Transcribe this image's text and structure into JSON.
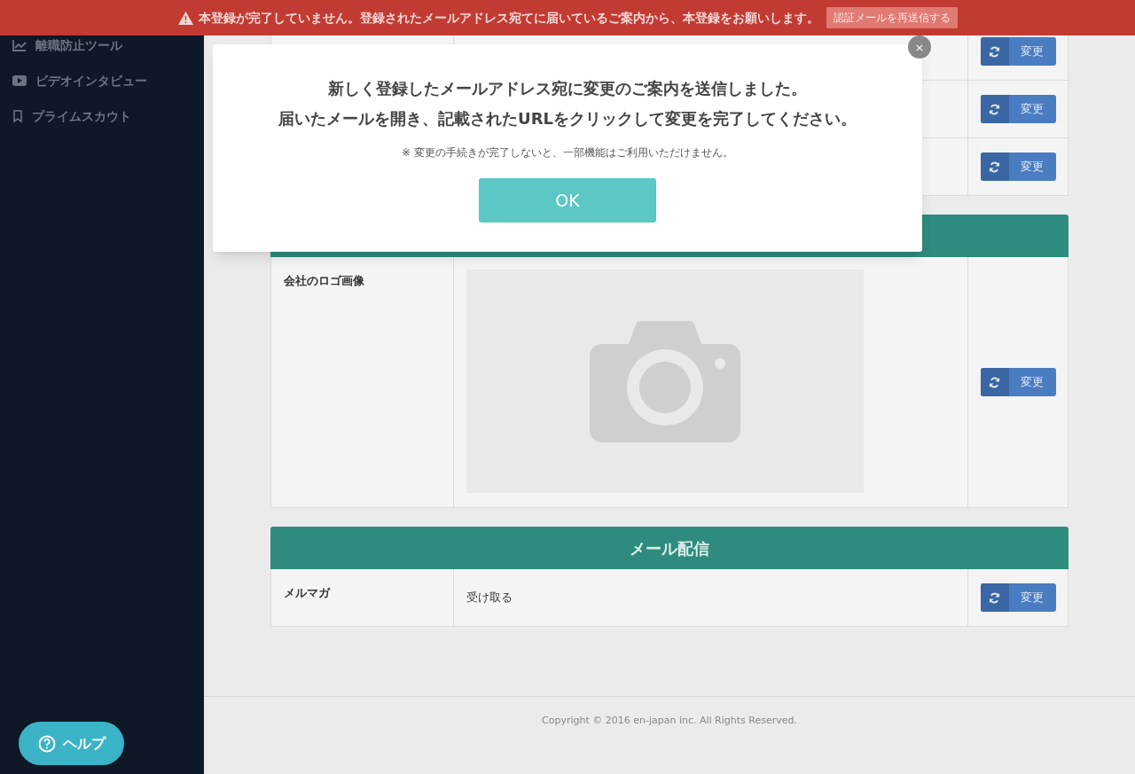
{
  "banner": {
    "message": "本登録が完了していません。登録されたメールアドレス宛てに届いているご案内から、本登録をお願いします。",
    "button": "認証メールを再送信する"
  },
  "sidebar": {
    "items": [
      {
        "kind": "chart",
        "label": "離職防止ツール"
      },
      {
        "kind": "video",
        "label": "ビデオインタビュー"
      },
      {
        "kind": "bookmark",
        "label": "プライムスカウト"
      }
    ]
  },
  "sections": [
    {
      "rows": [
        {
          "kind": "blank",
          "button": "変更"
        },
        {
          "kind": "blank",
          "button": "変更"
        },
        {
          "kind": "blank",
          "button": "変更"
        }
      ]
    },
    {
      "rows": [
        {
          "kind": "image",
          "label": "会社のロゴ画像",
          "button": "変更"
        }
      ]
    },
    {
      "title": "メール配信",
      "rows": [
        {
          "kind": "text",
          "label": "メルマガ",
          "value": "受け取る",
          "button": "変更"
        }
      ]
    }
  ],
  "footer": "Copyright © 2016 en-japan inc. All Rights Reserved.",
  "help_button": "ヘルプ",
  "modal": {
    "close": "×",
    "lines": [
      "新しく登録したメールアドレス宛に変更のご案内を送信しました。",
      "届いたメールを開き、記載されたURLをクリックして変更を完了してください。"
    ],
    "note": "※ 変更の手続きが完了しないと、一部機能はご利用いただけません。",
    "ok": "OK"
  }
}
